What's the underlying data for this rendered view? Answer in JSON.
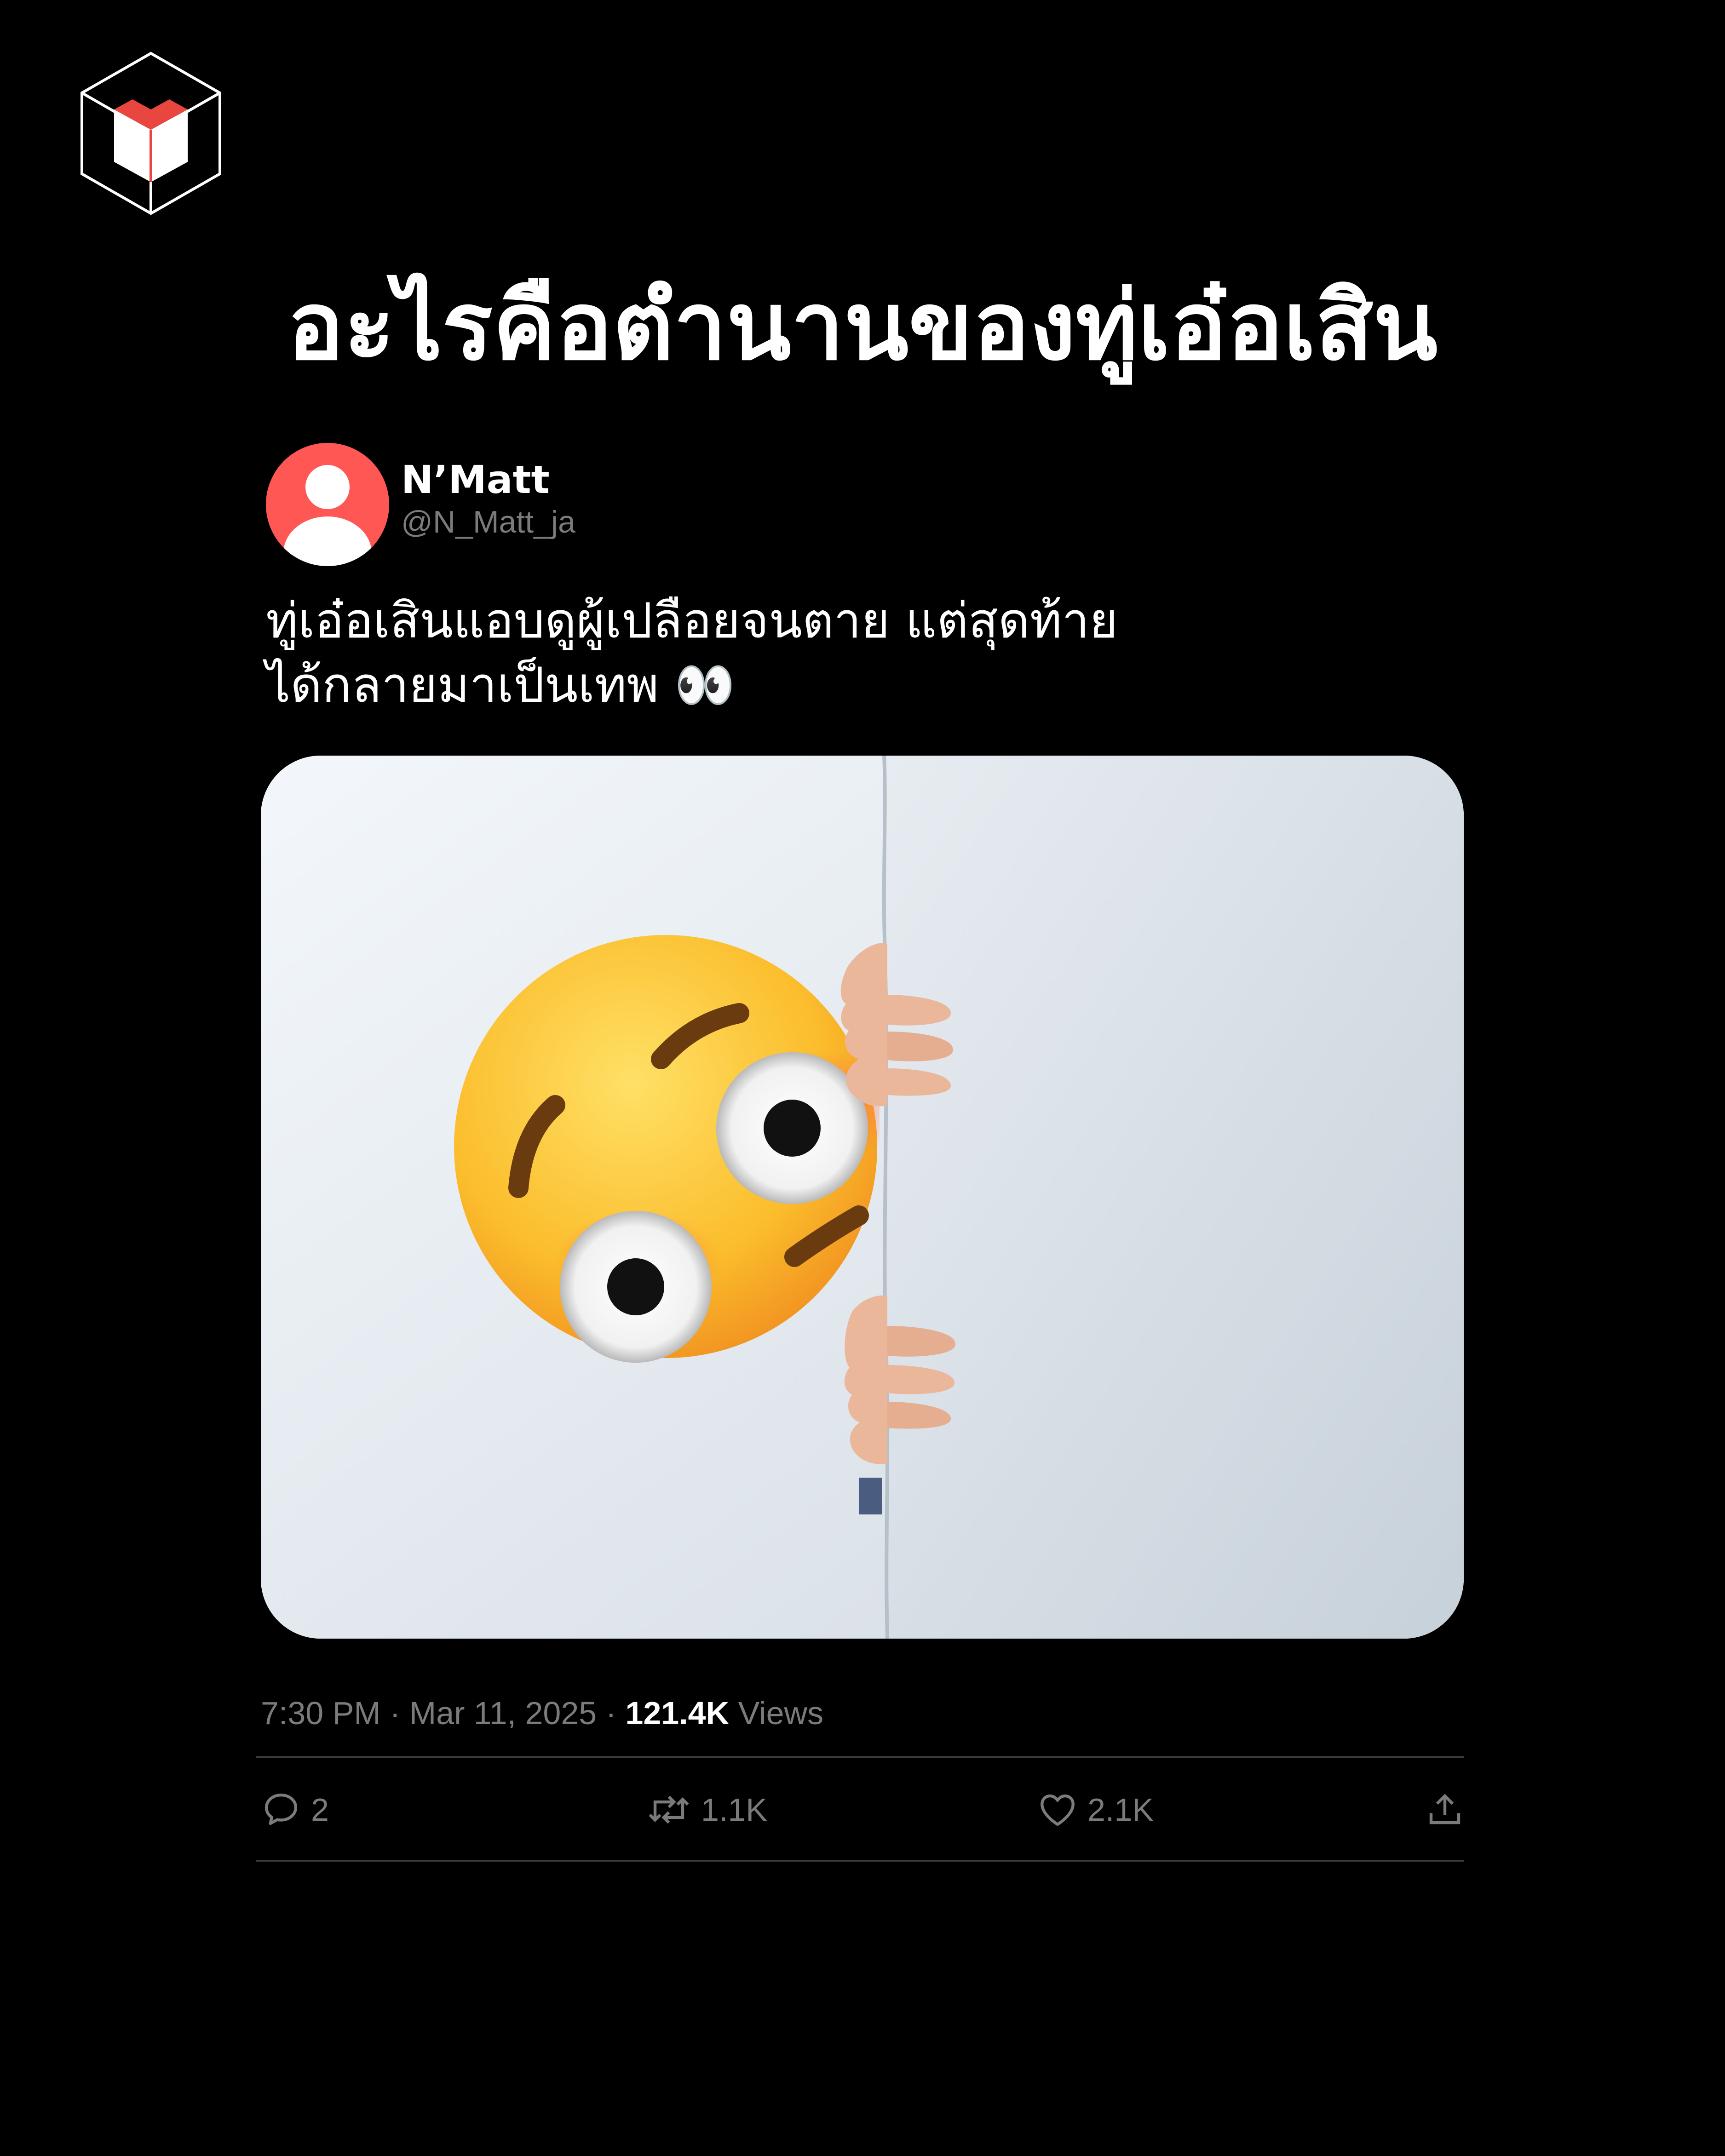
{
  "headline": "อะไรคือตำนานของทู่เอ๋อเสิน",
  "tweet": {
    "display_name": "N’Matt",
    "handle": "@N_Matt_ja",
    "text_line1": "ทู่เอ๋อเสินแอบดูผู้เปลือยจนตาย แต่สุดท้าย",
    "text_line2": "ได้กลายมาเป็นเทพ 👀",
    "media_description": "flushed-face emoji peeking from behind a white wall, hands gripping the edge",
    "time": "7:30 PM",
    "date": "Mar 11, 2025",
    "separator": "·",
    "views_count": "121.4K",
    "views_label": "Views"
  },
  "actions": {
    "replies": "2",
    "retweets": "1.1K",
    "likes": "2.1K"
  },
  "icons": {
    "logo": "cube-book-logo",
    "reply": "reply-icon",
    "retweet": "retweet-icon",
    "like": "heart-icon",
    "share": "share-icon"
  },
  "colors": {
    "background": "#000000",
    "avatar": "#ff5753",
    "muted_text": "#7b7b7b",
    "divider": "#3a3a3a",
    "logo_accent": "#e8463f"
  }
}
